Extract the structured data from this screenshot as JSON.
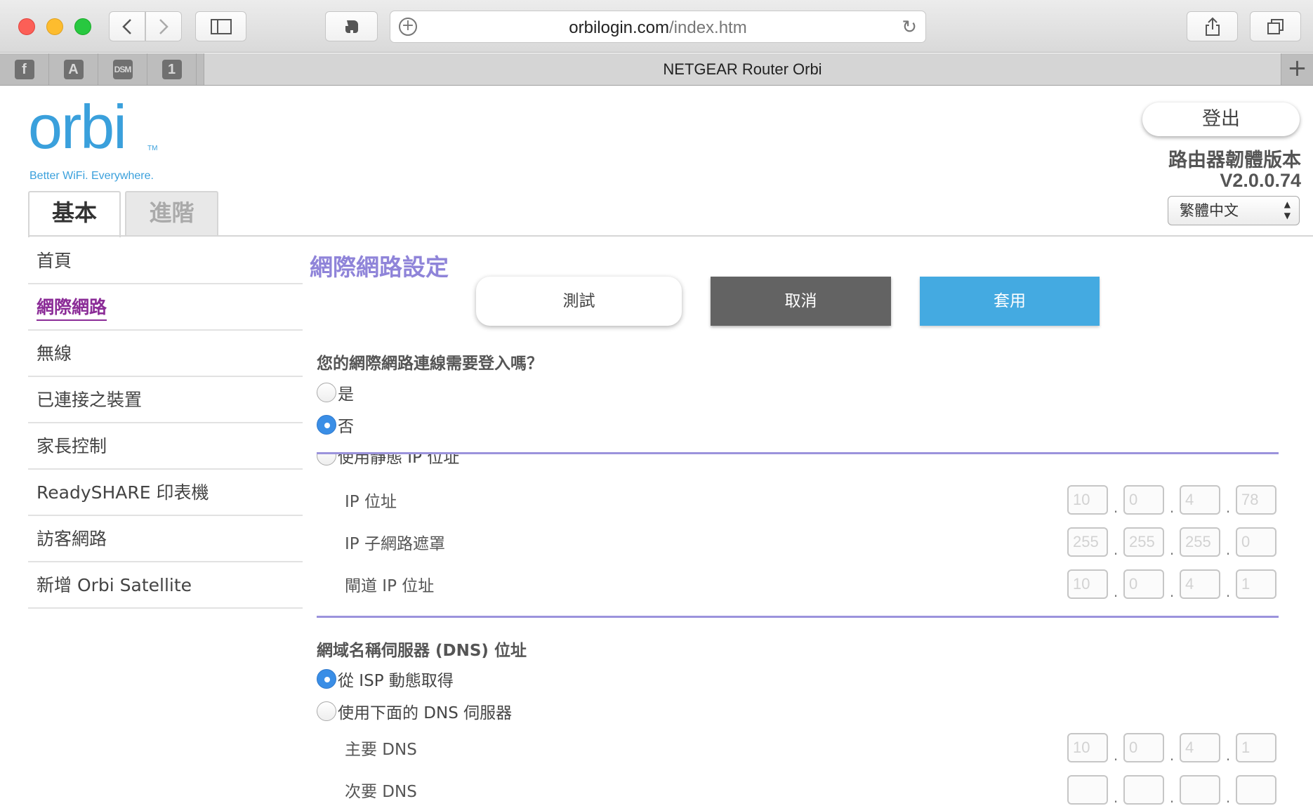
{
  "browser": {
    "url_host": "orbilogin.com",
    "url_path": "/index.htm",
    "tab_title": "NETGEAR Router Orbi",
    "favorites": [
      "f",
      "A",
      "DSM",
      "1"
    ]
  },
  "brand": {
    "logo_text": "orbi",
    "tm": "TM",
    "tagline": "Better WiFi. Everywhere.",
    "color": "#3aa0dc"
  },
  "tabs": {
    "basic": "基本",
    "advanced": "進階"
  },
  "header": {
    "logout": "登出",
    "firmware_label": "路由器韌體版本",
    "firmware_version": "V2.0.0.74",
    "language": "繁體中文"
  },
  "sidebar": {
    "items": [
      {
        "label": "首頁"
      },
      {
        "label": "網際網路"
      },
      {
        "label": "無線"
      },
      {
        "label": "已連接之裝置"
      },
      {
        "label": "家長控制"
      },
      {
        "label": "ReadySHARE 印表機"
      },
      {
        "label": "訪客網路"
      },
      {
        "label": "新增 Orbi Satellite"
      }
    ],
    "active_color": "#8b2c97"
  },
  "content": {
    "title": "網際網路設定",
    "buttons": {
      "test": "測試",
      "cancel": "取消",
      "apply": "套用"
    },
    "login_question": "您的網際網路連線需要登入嗎？",
    "login_yes": "是",
    "login_no": "否",
    "static_ip_option": "使用靜態 IP 位址",
    "ip_address_label": "IP 位址",
    "ip_address": [
      "10",
      "0",
      "4",
      "78"
    ],
    "subnet_label": "IP 子網路遮罩",
    "subnet": [
      "255",
      "255",
      "255",
      "0"
    ],
    "gateway_label": "閘道 IP 位址",
    "gateway": [
      "10",
      "0",
      "4",
      "1"
    ],
    "dns_title": "網域名稱伺服器 (DNS) 位址",
    "dns_from_isp": "從 ISP 動態取得",
    "dns_manual": "使用下面的 DNS 伺服器",
    "primary_dns_label": "主要 DNS",
    "primary_dns": [
      "10",
      "0",
      "4",
      "1"
    ],
    "secondary_dns_label": "次要 DNS",
    "secondary_dns": [
      "",
      "",
      "",
      ""
    ]
  }
}
